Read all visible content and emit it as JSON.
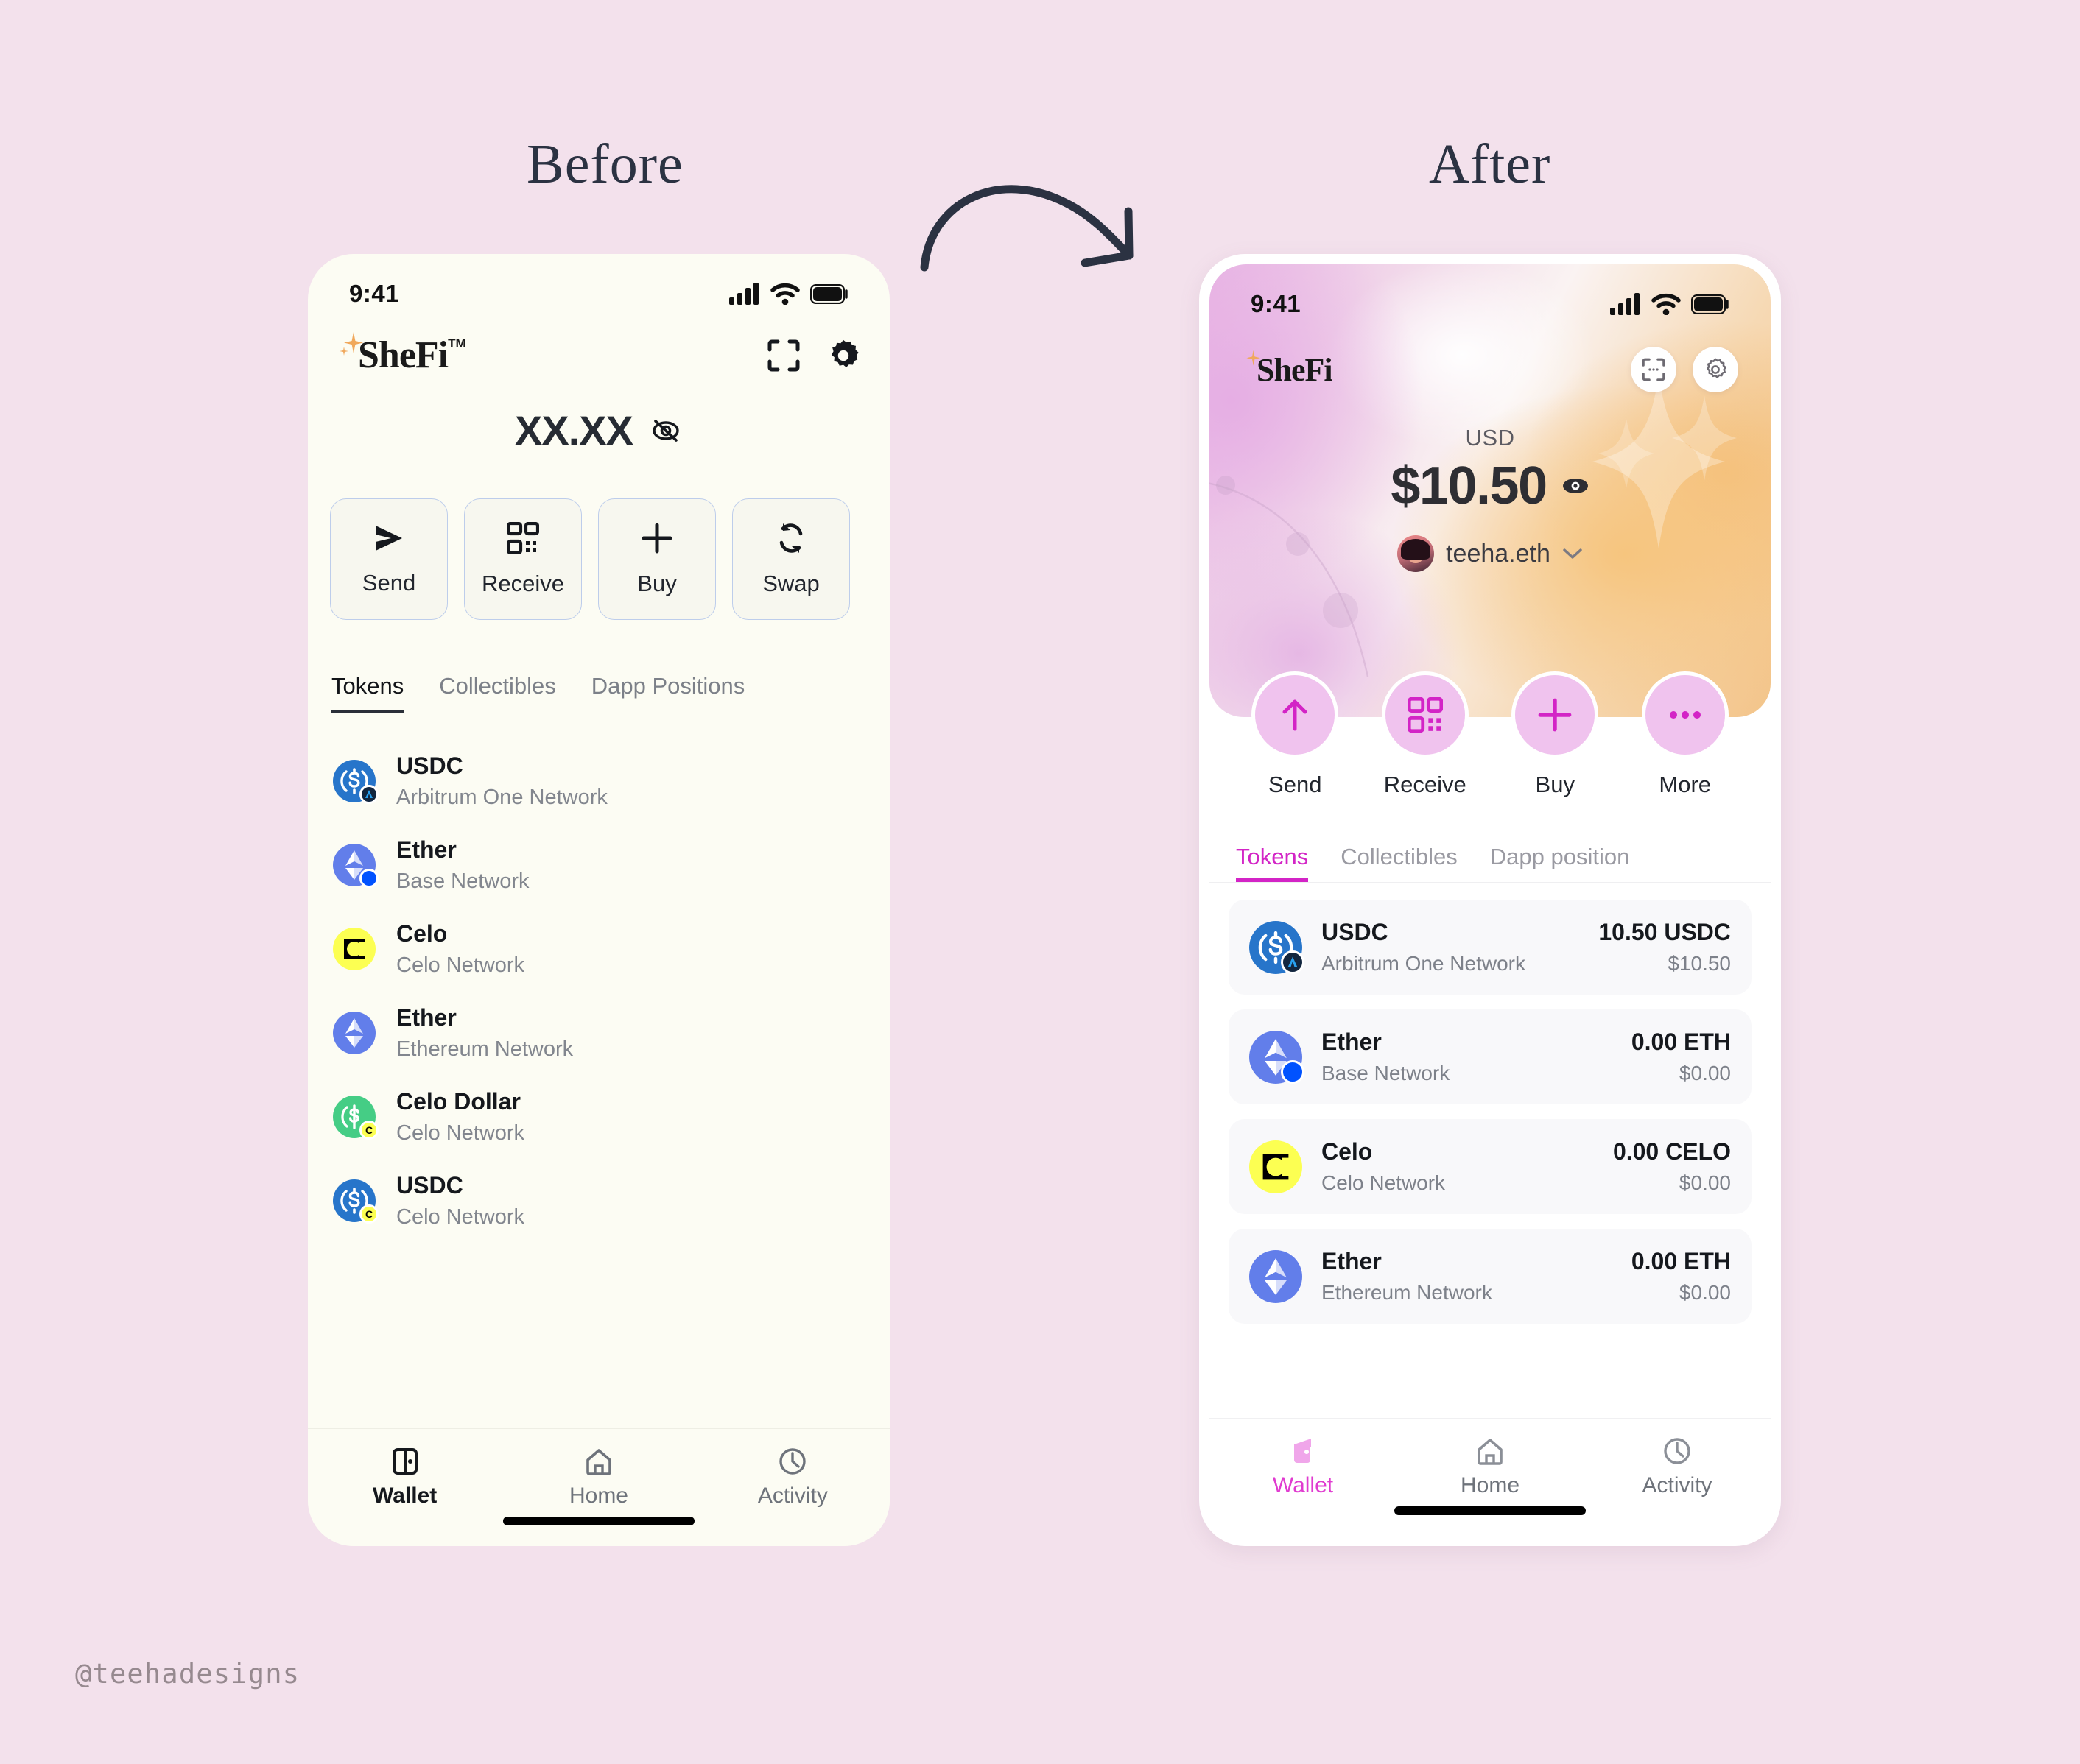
{
  "page": {
    "background_color": "#F3E1EC",
    "watermark": "@teehadesigns",
    "before_title": "Before",
    "after_title": "After"
  },
  "before": {
    "statusbar": {
      "time": "9:41"
    },
    "appbar": {
      "logo": "SheFi",
      "scan_icon": "scan-icon",
      "settings_icon": "gear-icon"
    },
    "balance": {
      "value": "XX.XX",
      "toggle_icon": "eye-off-icon"
    },
    "actions": [
      {
        "label": "Send",
        "icon": "send-arrow-icon"
      },
      {
        "label": "Receive",
        "icon": "qr-code-icon"
      },
      {
        "label": "Buy",
        "icon": "plus-icon"
      },
      {
        "label": "Swap",
        "icon": "swap-icon"
      }
    ],
    "tabs": [
      {
        "label": "Tokens",
        "active": true
      },
      {
        "label": "Collectibles",
        "active": false
      },
      {
        "label": "Dapp Positions",
        "active": false
      }
    ],
    "tokens": [
      {
        "name": "USDC",
        "network": "Arbitrum One Network",
        "icon": "usdc-coin-icon",
        "badge": "arbitrum"
      },
      {
        "name": "Ether",
        "network": "Base Network",
        "icon": "ether-coin-icon",
        "badge": "base"
      },
      {
        "name": "Celo",
        "network": "Celo Network",
        "icon": "celo-coin-icon",
        "badge": ""
      },
      {
        "name": "Ether",
        "network": "Ethereum Network",
        "icon": "ether-coin-icon",
        "badge": ""
      },
      {
        "name": "Celo Dollar",
        "network": "Celo Network",
        "icon": "celo-dollar-icon",
        "badge": "celo"
      },
      {
        "name": "USDC",
        "network": "Celo Network",
        "icon": "usdc-coin-icon",
        "badge": "celo"
      }
    ],
    "bottom_nav": [
      {
        "label": "Wallet",
        "icon": "wallet-icon",
        "active": true
      },
      {
        "label": "Home",
        "icon": "home-icon",
        "active": false
      },
      {
        "label": "Activity",
        "icon": "clock-icon",
        "active": false
      }
    ]
  },
  "after": {
    "statusbar": {
      "time": "9:41"
    },
    "appbar": {
      "logo": "SheFi",
      "scan_icon": "scan-icon",
      "settings_icon": "gear-icon"
    },
    "balance": {
      "currency_label": "USD",
      "value": "$10.50",
      "toggle_icon": "eye-icon",
      "ens_name": "teeha.eth",
      "chevron_icon": "chevron-down-icon"
    },
    "quick_actions": [
      {
        "label": "Send",
        "icon": "arrow-up-icon"
      },
      {
        "label": "Receive",
        "icon": "qr-code-icon"
      },
      {
        "label": "Buy",
        "icon": "plus-icon"
      },
      {
        "label": "More",
        "icon": "ellipsis-icon"
      }
    ],
    "tabs": [
      {
        "label": "Tokens",
        "active": true
      },
      {
        "label": "Collectibles",
        "active": false
      },
      {
        "label": "Dapp position",
        "active": false
      }
    ],
    "tokens": [
      {
        "name": "USDC",
        "network": "Arbitrum One Network",
        "amount": "10.50 USDC",
        "fiat": "$10.50",
        "icon": "usdc-coin-icon",
        "badge": "arbitrum"
      },
      {
        "name": "Ether",
        "network": "Base Network",
        "amount": "0.00 ETH",
        "fiat": "$0.00",
        "icon": "ether-coin-icon",
        "badge": "base"
      },
      {
        "name": "Celo",
        "network": "Celo Network",
        "amount": "0.00 CELO",
        "fiat": "$0.00",
        "icon": "celo-coin-icon",
        "badge": ""
      },
      {
        "name": "Ether",
        "network": "Ethereum Network",
        "amount": "0.00 ETH",
        "fiat": "$0.00",
        "icon": "ether-coin-icon",
        "badge": ""
      }
    ],
    "bottom_nav": [
      {
        "label": "Wallet",
        "icon": "wallet-icon",
        "active": true
      },
      {
        "label": "Home",
        "icon": "home-icon",
        "active": false
      },
      {
        "label": "Activity",
        "icon": "clock-icon",
        "active": false
      }
    ],
    "colors": {
      "accent": "#D324C6",
      "quick_action_bg": "#F0C3EE",
      "card_bg": "#F8F8FA"
    }
  }
}
